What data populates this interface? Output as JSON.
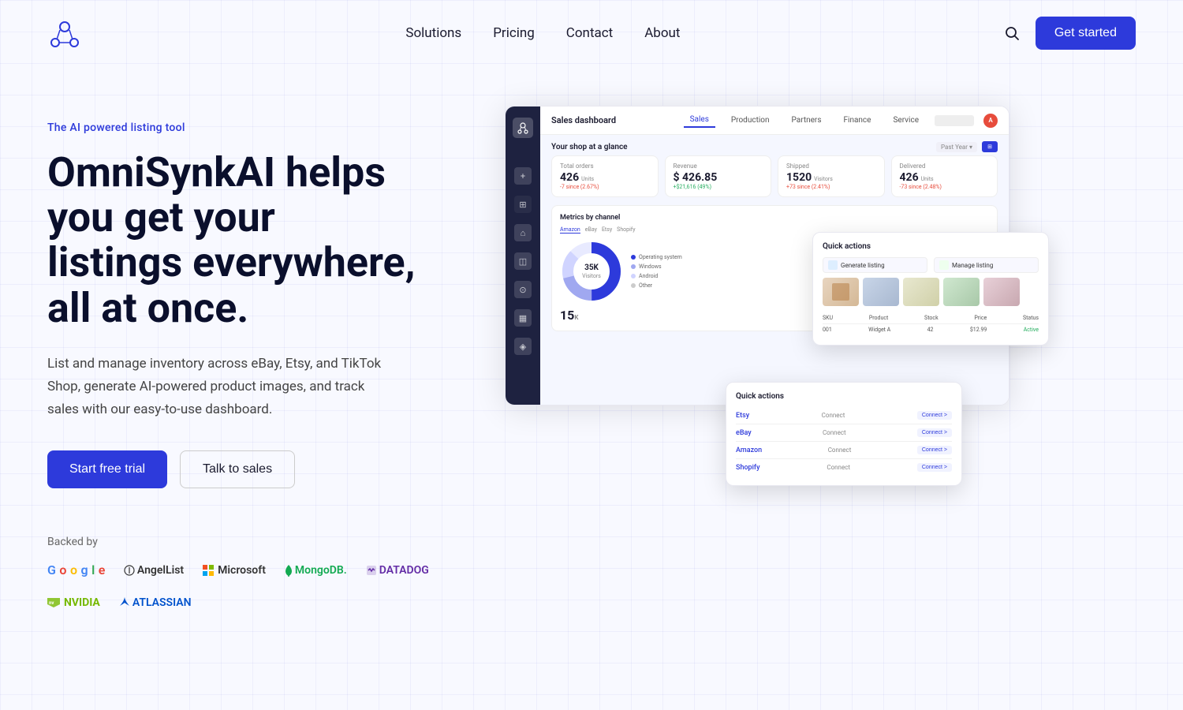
{
  "nav": {
    "logo_alt": "OmniSynkAI",
    "links": [
      {
        "id": "solutions",
        "label": "Solutions"
      },
      {
        "id": "pricing",
        "label": "Pricing"
      },
      {
        "id": "contact",
        "label": "Contact"
      },
      {
        "id": "about",
        "label": "About"
      }
    ],
    "cta_label": "Get started"
  },
  "hero": {
    "label": "The AI powered listing tool",
    "title_line1": "OmniSynkAI helps you get your",
    "title_line2": "listings everywhere, all at once.",
    "description": "List and manage inventory across eBay, Etsy, and TikTok Shop, generate AI-powered product images, and track sales with our easy-to-use dashboard.",
    "btn_primary": "Start free trial",
    "btn_secondary": "Talk to sales",
    "backed_label": "Backed by"
  },
  "backers": [
    {
      "id": "google",
      "label": "Google"
    },
    {
      "id": "angellist",
      "label": "AngelList"
    },
    {
      "id": "microsoft",
      "label": "Microsoft"
    },
    {
      "id": "mongodb",
      "label": "MongoDB"
    },
    {
      "id": "datadog",
      "label": "Datadog"
    },
    {
      "id": "nvidia",
      "label": "NVIDIA"
    },
    {
      "id": "atlassian",
      "label": "Atlassian"
    }
  ],
  "dashboard": {
    "title": "Sales dashboard",
    "tabs": [
      "Sales",
      "Production",
      "Partners",
      "Finance",
      "Service"
    ],
    "section_title": "Your shop at a glance",
    "metrics": [
      {
        "label": "Total orders",
        "value": "426",
        "unit": "Units",
        "delta": "-7 since (2.67%)",
        "positive": false
      },
      {
        "label": "Revenue",
        "value": "$ 426.85",
        "unit": "",
        "delta": "+$21,616 (49%)",
        "positive": true
      },
      {
        "label": "Shipped",
        "value": "1520",
        "unit": "Visitors",
        "delta": "+73 since (2.41%)",
        "positive": false
      },
      {
        "label": "Delivered",
        "value": "426",
        "unit": "Units",
        "delta": "-73 since (2.48%)",
        "positive": false
      }
    ],
    "chart_title": "Metrics by channel",
    "chart_tabs": [
      "Amazon",
      "eBay",
      "Etsy",
      "Shopify"
    ],
    "donut_value": "35K",
    "donut_label": "Visitors",
    "legend": [
      {
        "label": "Operating system",
        "color": "#2d3adb"
      },
      {
        "label": "Windows",
        "color": "#a0a8f0"
      },
      {
        "label": "Android",
        "color": "#e8eaff"
      },
      {
        "label": "Other",
        "color": "#ccc"
      }
    ],
    "quick_actions_title": "Quick actions",
    "quick_actions": [
      {
        "label": "Generate listing"
      },
      {
        "label": "Manage listing"
      }
    ],
    "panel2_title": "Quick actions",
    "marketplaces": [
      {
        "name": "Etsy",
        "label": "Etsy",
        "action": "Connect >"
      },
      {
        "name": "eBay",
        "label": "eBay",
        "action": "Connect >"
      },
      {
        "name": "Amazon",
        "label": "Amazon",
        "action": "Connect >"
      },
      {
        "name": "Shopify",
        "label": "Shopify",
        "action": "Connect >"
      }
    ]
  }
}
